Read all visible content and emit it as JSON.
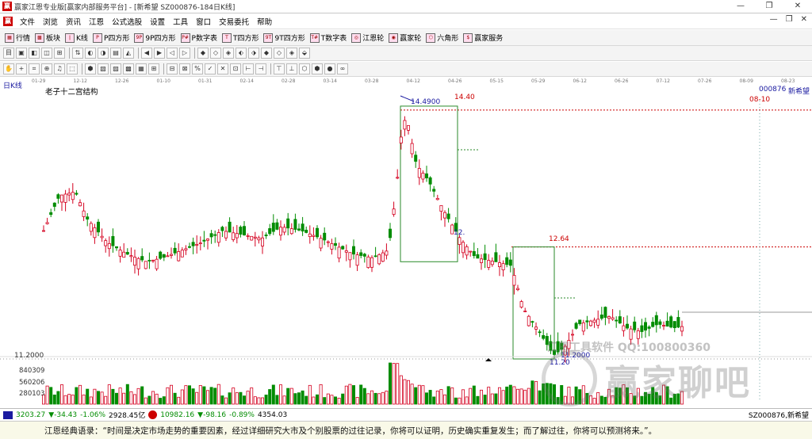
{
  "window": {
    "title": "赢家江恩专业版[赢家内部服务平台] - [新希望  SZ000876-184日K线]",
    "controls": [
      "—",
      "❐",
      "✕"
    ]
  },
  "menu": {
    "items": [
      "文件",
      "浏览",
      "资讯",
      "江恩",
      "公式选股",
      "设置",
      "工具",
      "窗口",
      "交易委托",
      "帮助"
    ],
    "right_controls": [
      "—",
      "❐",
      "✕"
    ]
  },
  "toolbar1": {
    "items": [
      "行情",
      "板块",
      "K线",
      "P四方形",
      "9P四方形",
      "P数字表",
      "T四方形",
      "9T四方形",
      "T数字表",
      "江恩轮",
      "赢家轮",
      "六角形",
      "赢家服务"
    ]
  },
  "chart": {
    "period_label": "日K线",
    "study_title": "老子十二宫结构",
    "stock_code": "000876",
    "stock_name": "新希望",
    "date_label": "08-10",
    "date_axis": [
      "01-29",
      "12-12",
      "12-26",
      "01-10",
      "01-31",
      "02-14",
      "02-28",
      "03-14",
      "03-28",
      "04-12",
      "04-26",
      "05-15",
      "05-29",
      "06-12",
      "06-26",
      "07-12",
      "07-26",
      "08-09",
      "08-23"
    ],
    "price_labels": {
      "high_box": "14.4900",
      "high_line": "14.40",
      "mid_box": "12.64",
      "left_mid": "12.",
      "low_box": "11.2000",
      "low_left": "11.20",
      "low_label": "11.20",
      "axis_low": "11.2000"
    },
    "volume_axis": [
      "840309",
      "560206",
      "280103"
    ]
  },
  "chart_data": {
    "type": "candlestick",
    "title": "老子十二宫结构",
    "symbol": "SZ000876",
    "series_name": "新希望",
    "ylim": [
      11.0,
      14.6
    ],
    "key_levels": [
      14.49,
      14.4,
      12.64,
      11.2
    ]
  },
  "watermark": {
    "line1": "江恩工具软件  QQ:100800360",
    "line2": "赢家聊吧"
  },
  "status": {
    "sh_index": "3203.27",
    "sh_change": "▼-34.43",
    "sh_pct": "-1.06%",
    "sh_amount": "2928.45亿",
    "sz_index": "10982.16",
    "sz_change": "▼-98.16",
    "sz_pct": "-0.89%",
    "sz_amount": "4354.03",
    "stock": "SZ000876,新希望"
  },
  "quote": "江恩经典语录：“时间是决定市场走势的重要因素，经过详细研究大市及个别股票的过往记录，你将可以证明，历史确实重复发生；而了解过往，你将可以预测将来。”。",
  "colors": {
    "up": "#d4001f",
    "down": "#008c00",
    "grid_red": "#cc0000",
    "box_green": "#2a8a2a",
    "accent_blue": "#1a1aa0"
  }
}
